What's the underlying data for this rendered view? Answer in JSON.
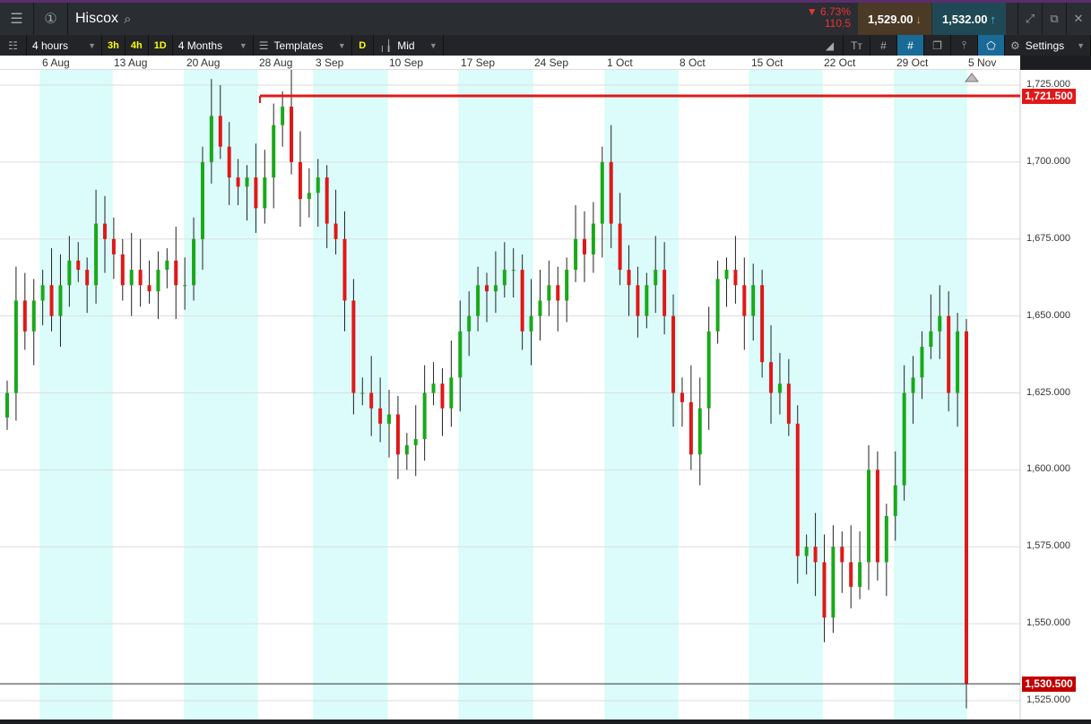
{
  "header": {
    "title": "Hiscox",
    "change_pct": "6.73%",
    "change_abs": "110.5",
    "sell_price": "1,529.00",
    "buy_price": "1,532.00"
  },
  "toolbar": {
    "interval": "4 hours",
    "quick": [
      "3h",
      "4h",
      "1D"
    ],
    "range": "4 Months",
    "templates": "Templates",
    "d_label": "D",
    "price_type": "Mid",
    "settings": "Settings"
  },
  "colors": {
    "up": "#1aa81a",
    "down": "#e01818",
    "week_shade": "#dcfcfc",
    "line": "#e01818"
  },
  "chart_data": {
    "type": "candlestick",
    "x_ticks": [
      "6 Aug",
      "13 Aug",
      "20 Aug",
      "28 Aug",
      "3 Sep",
      "10 Sep",
      "17 Sep",
      "24 Sep",
      "1 Oct",
      "8 Oct",
      "15 Oct",
      "22 Oct",
      "29 Oct",
      "5 Nov"
    ],
    "y_ticks": [
      "1,725.000",
      "1,700.000",
      "1,675.000",
      "1,650.000",
      "1,625.000",
      "1,600.000",
      "1,575.000",
      "1,550.000",
      "1,525.000"
    ],
    "ylim": [
      1522,
      1731
    ],
    "horizontal_line": {
      "value": 1721.5,
      "label": "1,721.500"
    },
    "last_price": {
      "value": 1530.5,
      "label": "1,530.500"
    },
    "close": [
      1625,
      1655,
      1645,
      1655,
      1660,
      1650,
      1660,
      1668,
      1665,
      1660,
      1680,
      1675,
      1670,
      1660,
      1665,
      1660,
      1658,
      1665,
      1668,
      1660,
      1660,
      1675,
      1700,
      1715,
      1705,
      1695,
      1692,
      1695,
      1685,
      1695,
      1712,
      1718,
      1700,
      1688,
      1690,
      1695,
      1680,
      1675,
      1655,
      1625,
      1625,
      1620,
      1615,
      1618,
      1605,
      1608,
      1610,
      1625,
      1628,
      1620,
      1630,
      1645,
      1650,
      1660,
      1658,
      1660,
      1665,
      1665,
      1645,
      1650,
      1655,
      1660,
      1655,
      1665,
      1675,
      1670,
      1680,
      1700,
      1680,
      1665,
      1660,
      1650,
      1660,
      1665,
      1650,
      1625,
      1622,
      1605,
      1620,
      1645,
      1662,
      1665,
      1660,
      1650,
      1660,
      1635,
      1625,
      1628,
      1615,
      1572,
      1575,
      1570,
      1552,
      1575,
      1570,
      1562,
      1570,
      1600,
      1570,
      1585,
      1595,
      1625,
      1630,
      1640,
      1645,
      1650,
      1625,
      1645,
      1530.5
    ]
  }
}
